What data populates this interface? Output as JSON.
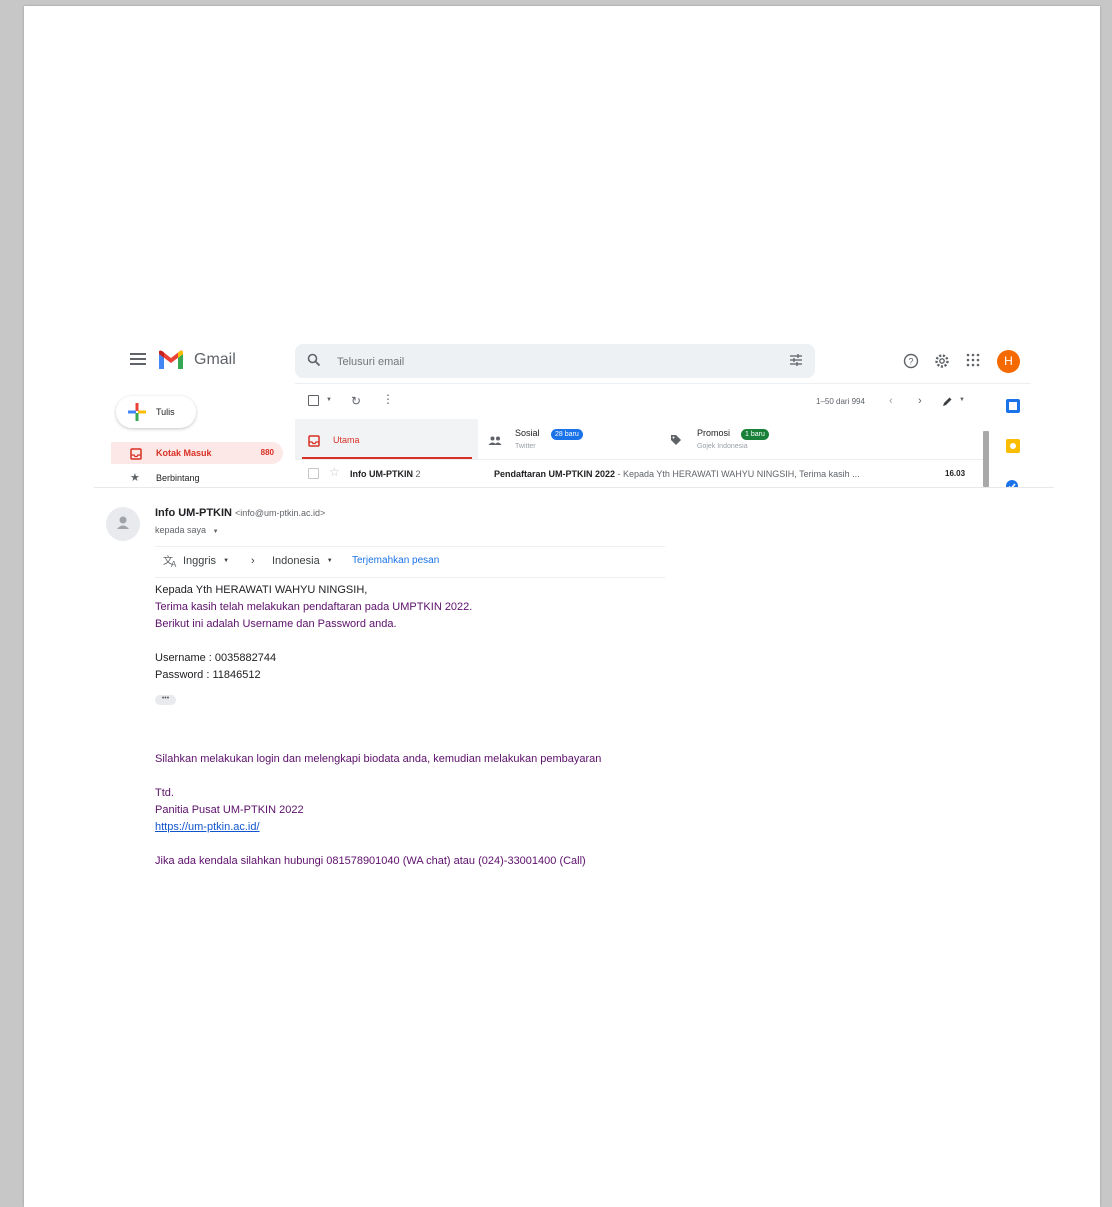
{
  "app": {
    "name": "Gmail"
  },
  "search": {
    "placeholder": "Telusuri email"
  },
  "account": {
    "initial": "H"
  },
  "sidebar": {
    "compose_label": "Tulis",
    "items": [
      {
        "label": "Kotak Masuk",
        "count": "880"
      },
      {
        "label": "Berbintang"
      }
    ]
  },
  "toolbar": {
    "range": "1–50 dari 994"
  },
  "tabs": [
    {
      "label": "Utama"
    },
    {
      "label": "Sosial",
      "badge": "28 baru",
      "sub": "Twitter"
    },
    {
      "label": "Promosi",
      "badge": "1 baru",
      "sub": "Gojek Indonesia"
    }
  ],
  "row": {
    "sender": "Info UM-PTKIN",
    "count": "2",
    "subject": "Pendaftaran UM-PTKIN 2022",
    "snippet": " - Kepada Yth HERAWATI WAHYU NINGSIH, Terima kasih ...",
    "time": "16.03"
  },
  "email": {
    "sender_name": "Info UM-PTKIN",
    "sender_email": "<info@um-ptkin.ac.id>",
    "to": "kepada saya",
    "translate": {
      "from": "Inggris",
      "to": "Indonesia",
      "action": "Terjemahkan pesan"
    },
    "lines": {
      "greeting": "Kepada Yth HERAWATI WAHYU NINGSIH,",
      "thanks": "Terima kasih telah melakukan pendaftaran pada UMPTKIN 2022.",
      "intro": "Berikut ini adalah Username dan Password anda.",
      "username": "Username : 0035882744",
      "password": "Password : 11846512",
      "instruction": "Silahkan melakukan login dan melengkapi biodata anda, kemudian melakukan pembayaran",
      "sign": "Ttd.",
      "committee": "Panitia Pusat UM-PTKIN 2022",
      "url": "https://um-ptkin.ac.id/",
      "contact": "Jika ada kendala silahkan hubungi 081578901040 (WA chat) atau (024)-33001400 (Call)"
    }
  },
  "colors": {
    "accent_red": "#d93025",
    "blue": "#1a73e8",
    "green": "#188038",
    "purple_text": "#5c0f6b"
  }
}
